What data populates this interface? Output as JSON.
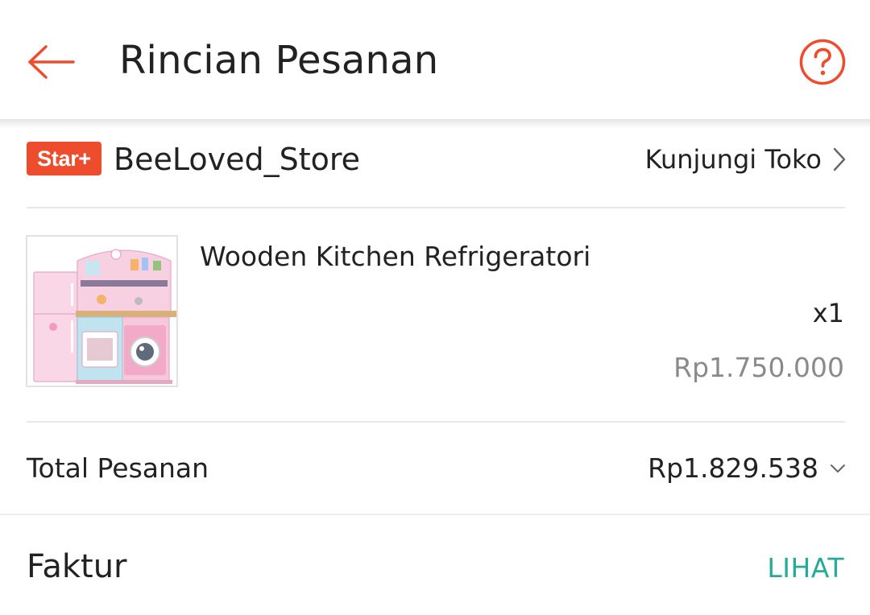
{
  "header": {
    "title": "Rincian Pesanan",
    "accent_color": "#ee4d2d",
    "back_icon": "arrow-left-icon",
    "help_icon": "question-circle-icon"
  },
  "shop": {
    "badge": "Star+",
    "badge_color": "#ee4d2d",
    "name": "BeeLoved_Store",
    "visit_label": "Kunjungi Toko",
    "visit_icon": "chevron-right-icon"
  },
  "product": {
    "name": "Wooden Kitchen Refrigeratori",
    "quantity": "x1",
    "price": "Rp1.750.000",
    "image_icon": "toy-kitchen-image"
  },
  "order_total": {
    "label": "Total Pesanan",
    "value": "Rp1.829.538",
    "expand_icon": "chevron-down-icon"
  },
  "invoice": {
    "label": "Faktur",
    "action": "LIHAT",
    "action_color": "#26aa99"
  }
}
